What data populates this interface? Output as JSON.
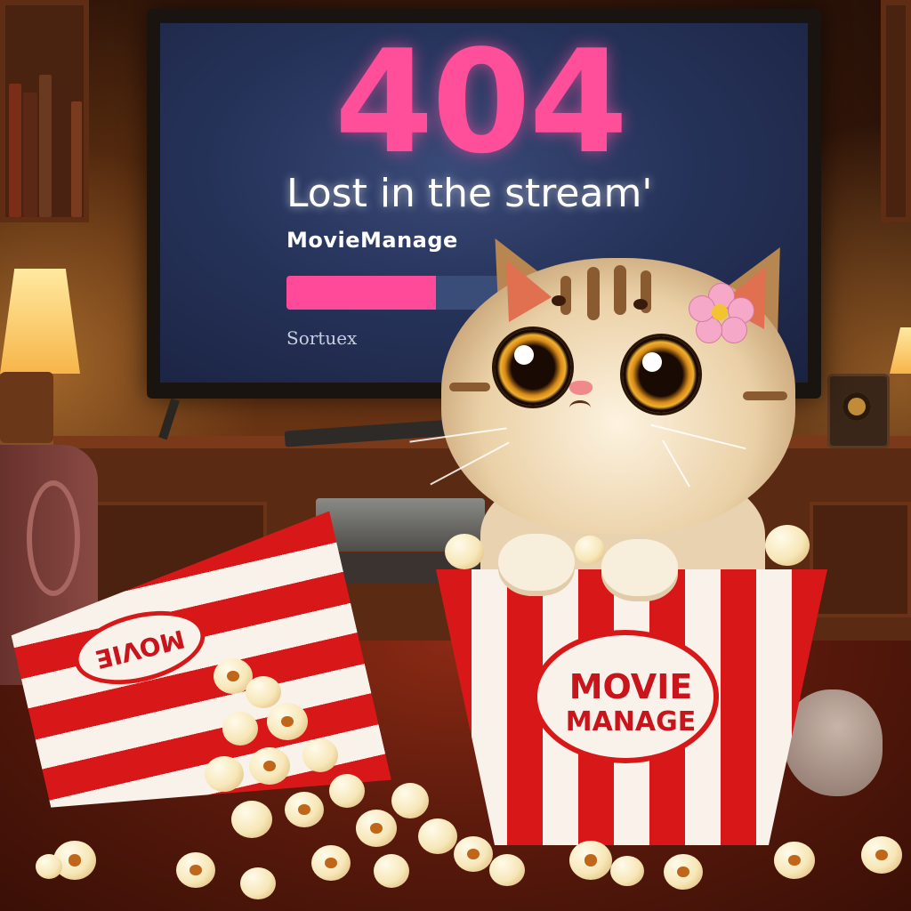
{
  "screen": {
    "error_code": "404",
    "tagline": "Lost in the stream'",
    "brand": "MovieManage",
    "progress_fraction": 0.7,
    "source_label": "Sortuex"
  },
  "bucket": {
    "label_line1": "MOVIE",
    "label_line2": "MANAGE"
  },
  "tipped_bucket": {
    "label": "MOVIE"
  },
  "colors": {
    "error_pink": "#ff4f9a",
    "progress_fill": "#ff4a9a",
    "bucket_red": "#d81818"
  }
}
